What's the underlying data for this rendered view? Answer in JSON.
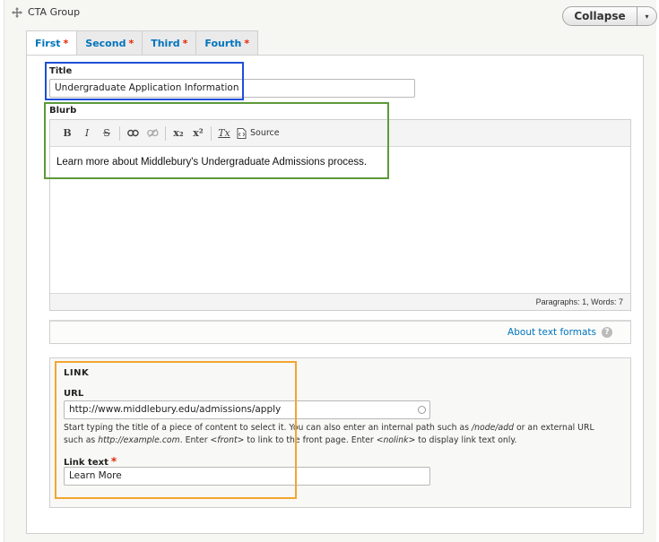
{
  "group": {
    "title": "CTA Group",
    "collapse_label": "Collapse",
    "toggle_glyph": "▾"
  },
  "tabs": [
    {
      "label": "First",
      "required": "*",
      "active": true
    },
    {
      "label": "Second",
      "required": "*",
      "active": false
    },
    {
      "label": "Third",
      "required": "*",
      "active": false
    },
    {
      "label": "Fourth",
      "required": "*",
      "active": false
    }
  ],
  "title_field": {
    "label": "Title",
    "value": "Undergraduate Application Information"
  },
  "blurb_field": {
    "label": "Blurb",
    "toolbar": {
      "bold": "B",
      "italic": "I",
      "strike": "S",
      "subscript": "x₂",
      "superscript": "x²",
      "remove_format": "Tx",
      "source": "Source"
    },
    "content": "Learn more about Middlebury's Undergraduate Admissions process.",
    "status": "Paragraphs: 1, Words: 7"
  },
  "text_formats": {
    "link_label": "About text formats",
    "help_glyph": "?"
  },
  "link_group": {
    "legend": "LINK",
    "url_label": "URL",
    "url_value": "http://www.middlebury.edu/admissions/apply",
    "help_line1_a": "Start typing the title of a piece of content to select it. You can also enter an internal path such as ",
    "help_path": "/node/add",
    "help_line1_b": " or an external URL",
    "help_line2_a": "such as ",
    "help_example": "http://example.com",
    "help_line2_b": ". Enter ",
    "help_front": "<front>",
    "help_line2_c": " to link to the front page. Enter ",
    "help_nolink": "<nolink>",
    "help_line2_d": " to display link text only.",
    "text_label": "Link text",
    "text_required": "*",
    "text_value": "Learn More"
  },
  "colors": {
    "link": "#0074bd",
    "required": "#e62600",
    "highlight_title": "#1f4fd6",
    "highlight_blurb": "#5c9a3a",
    "highlight_link": "#f2a531"
  }
}
